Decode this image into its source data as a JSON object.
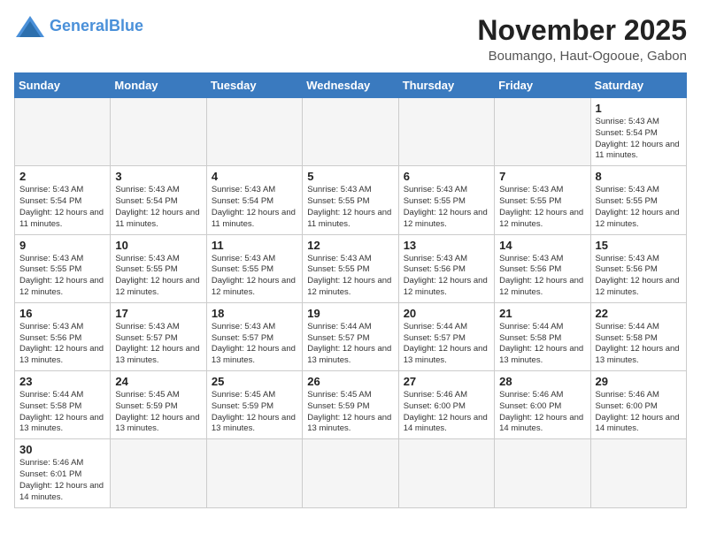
{
  "header": {
    "logo_general": "General",
    "logo_blue": "Blue",
    "month_title": "November 2025",
    "location": "Boumango, Haut-Ogooue, Gabon"
  },
  "weekdays": [
    "Sunday",
    "Monday",
    "Tuesday",
    "Wednesday",
    "Thursday",
    "Friday",
    "Saturday"
  ],
  "weeks": [
    [
      {
        "day": "",
        "info": ""
      },
      {
        "day": "",
        "info": ""
      },
      {
        "day": "",
        "info": ""
      },
      {
        "day": "",
        "info": ""
      },
      {
        "day": "",
        "info": ""
      },
      {
        "day": "",
        "info": ""
      },
      {
        "day": "1",
        "info": "Sunrise: 5:43 AM\nSunset: 5:54 PM\nDaylight: 12 hours and 11 minutes."
      }
    ],
    [
      {
        "day": "2",
        "info": "Sunrise: 5:43 AM\nSunset: 5:54 PM\nDaylight: 12 hours and 11 minutes."
      },
      {
        "day": "3",
        "info": "Sunrise: 5:43 AM\nSunset: 5:54 PM\nDaylight: 12 hours and 11 minutes."
      },
      {
        "day": "4",
        "info": "Sunrise: 5:43 AM\nSunset: 5:54 PM\nDaylight: 12 hours and 11 minutes."
      },
      {
        "day": "5",
        "info": "Sunrise: 5:43 AM\nSunset: 5:55 PM\nDaylight: 12 hours and 11 minutes."
      },
      {
        "day": "6",
        "info": "Sunrise: 5:43 AM\nSunset: 5:55 PM\nDaylight: 12 hours and 12 minutes."
      },
      {
        "day": "7",
        "info": "Sunrise: 5:43 AM\nSunset: 5:55 PM\nDaylight: 12 hours and 12 minutes."
      },
      {
        "day": "8",
        "info": "Sunrise: 5:43 AM\nSunset: 5:55 PM\nDaylight: 12 hours and 12 minutes."
      }
    ],
    [
      {
        "day": "9",
        "info": "Sunrise: 5:43 AM\nSunset: 5:55 PM\nDaylight: 12 hours and 12 minutes."
      },
      {
        "day": "10",
        "info": "Sunrise: 5:43 AM\nSunset: 5:55 PM\nDaylight: 12 hours and 12 minutes."
      },
      {
        "day": "11",
        "info": "Sunrise: 5:43 AM\nSunset: 5:55 PM\nDaylight: 12 hours and 12 minutes."
      },
      {
        "day": "12",
        "info": "Sunrise: 5:43 AM\nSunset: 5:55 PM\nDaylight: 12 hours and 12 minutes."
      },
      {
        "day": "13",
        "info": "Sunrise: 5:43 AM\nSunset: 5:56 PM\nDaylight: 12 hours and 12 minutes."
      },
      {
        "day": "14",
        "info": "Sunrise: 5:43 AM\nSunset: 5:56 PM\nDaylight: 12 hours and 12 minutes."
      },
      {
        "day": "15",
        "info": "Sunrise: 5:43 AM\nSunset: 5:56 PM\nDaylight: 12 hours and 12 minutes."
      }
    ],
    [
      {
        "day": "16",
        "info": "Sunrise: 5:43 AM\nSunset: 5:56 PM\nDaylight: 12 hours and 13 minutes."
      },
      {
        "day": "17",
        "info": "Sunrise: 5:43 AM\nSunset: 5:57 PM\nDaylight: 12 hours and 13 minutes."
      },
      {
        "day": "18",
        "info": "Sunrise: 5:43 AM\nSunset: 5:57 PM\nDaylight: 12 hours and 13 minutes."
      },
      {
        "day": "19",
        "info": "Sunrise: 5:44 AM\nSunset: 5:57 PM\nDaylight: 12 hours and 13 minutes."
      },
      {
        "day": "20",
        "info": "Sunrise: 5:44 AM\nSunset: 5:57 PM\nDaylight: 12 hours and 13 minutes."
      },
      {
        "day": "21",
        "info": "Sunrise: 5:44 AM\nSunset: 5:58 PM\nDaylight: 12 hours and 13 minutes."
      },
      {
        "day": "22",
        "info": "Sunrise: 5:44 AM\nSunset: 5:58 PM\nDaylight: 12 hours and 13 minutes."
      }
    ],
    [
      {
        "day": "23",
        "info": "Sunrise: 5:44 AM\nSunset: 5:58 PM\nDaylight: 12 hours and 13 minutes."
      },
      {
        "day": "24",
        "info": "Sunrise: 5:45 AM\nSunset: 5:59 PM\nDaylight: 12 hours and 13 minutes."
      },
      {
        "day": "25",
        "info": "Sunrise: 5:45 AM\nSunset: 5:59 PM\nDaylight: 12 hours and 13 minutes."
      },
      {
        "day": "26",
        "info": "Sunrise: 5:45 AM\nSunset: 5:59 PM\nDaylight: 12 hours and 13 minutes."
      },
      {
        "day": "27",
        "info": "Sunrise: 5:46 AM\nSunset: 6:00 PM\nDaylight: 12 hours and 14 minutes."
      },
      {
        "day": "28",
        "info": "Sunrise: 5:46 AM\nSunset: 6:00 PM\nDaylight: 12 hours and 14 minutes."
      },
      {
        "day": "29",
        "info": "Sunrise: 5:46 AM\nSunset: 6:00 PM\nDaylight: 12 hours and 14 minutes."
      }
    ],
    [
      {
        "day": "30",
        "info": "Sunrise: 5:46 AM\nSunset: 6:01 PM\nDaylight: 12 hours and 14 minutes."
      },
      {
        "day": "",
        "info": ""
      },
      {
        "day": "",
        "info": ""
      },
      {
        "day": "",
        "info": ""
      },
      {
        "day": "",
        "info": ""
      },
      {
        "day": "",
        "info": ""
      },
      {
        "day": "",
        "info": ""
      }
    ]
  ]
}
